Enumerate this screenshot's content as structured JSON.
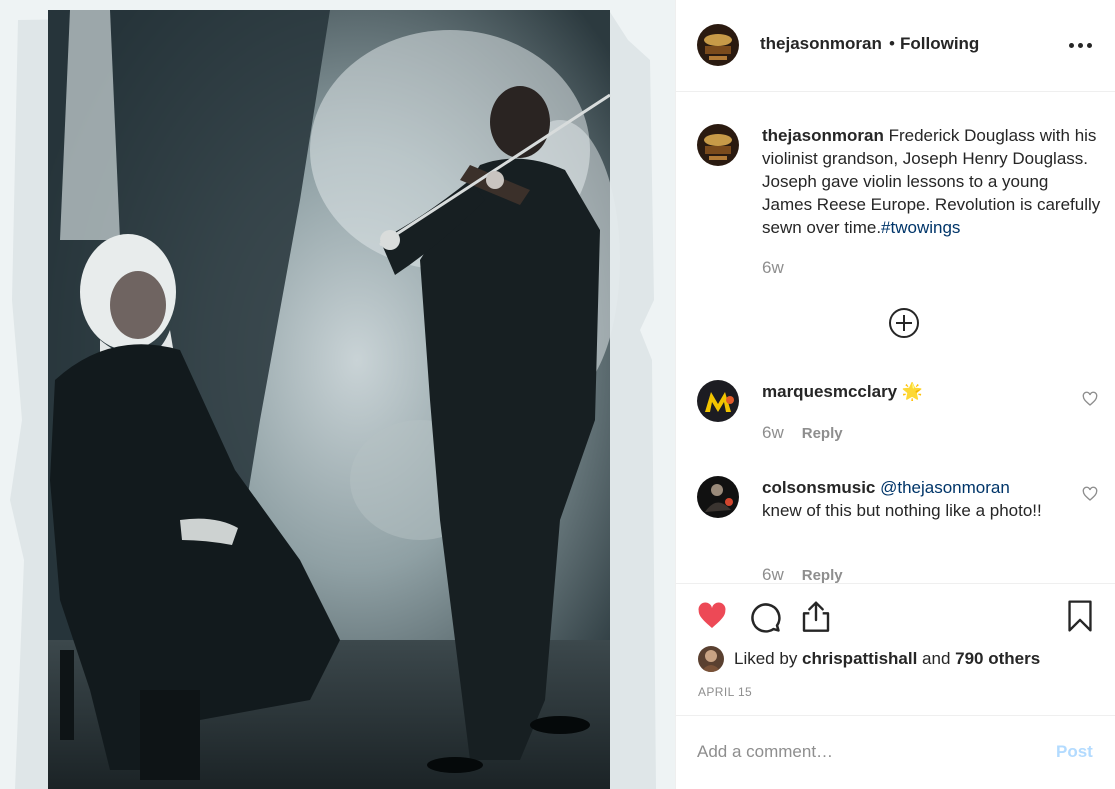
{
  "post": {
    "username": "thejasonmoran",
    "separator": "•",
    "follow_status": "Following",
    "more_icon": "ellipsis-icon"
  },
  "caption": {
    "username": "thejasonmoran",
    "text": " Frederick Douglass with his violinist grandson, Joseph Henry Douglass. Joseph gave violin lessons to a young James Reese Europe. Revolution is carefully sewn over time.",
    "hashtag": "#twowings",
    "time": "6w"
  },
  "load_more_icon": "plus-circle-icon",
  "comments": [
    {
      "username": "marquesmcclary",
      "emoji": "🌟",
      "text": "",
      "mention": "",
      "time": "6w",
      "reply_label": "Reply"
    },
    {
      "username": "colsonsmusic",
      "mention": "@thejasonmoran",
      "text": " knew of this but nothing like a photo!!",
      "time": "6w",
      "reply_label": "Reply"
    }
  ],
  "actions": {
    "like_icon": "heart-filled-icon",
    "comment_icon": "comment-icon",
    "share_icon": "share-icon",
    "save_icon": "bookmark-icon",
    "like_color": "#ed4956"
  },
  "likes": {
    "prefix": "Liked by ",
    "user": "chrispattishall",
    "middle": " and ",
    "others": "790 others"
  },
  "date": "APRIL 15",
  "comment_box": {
    "placeholder": "Add a comment…",
    "post_label": "Post",
    "post_color": "#b3dbff"
  },
  "colors": {
    "link": "#003569",
    "muted": "#8e8e8e",
    "text": "#262626"
  }
}
